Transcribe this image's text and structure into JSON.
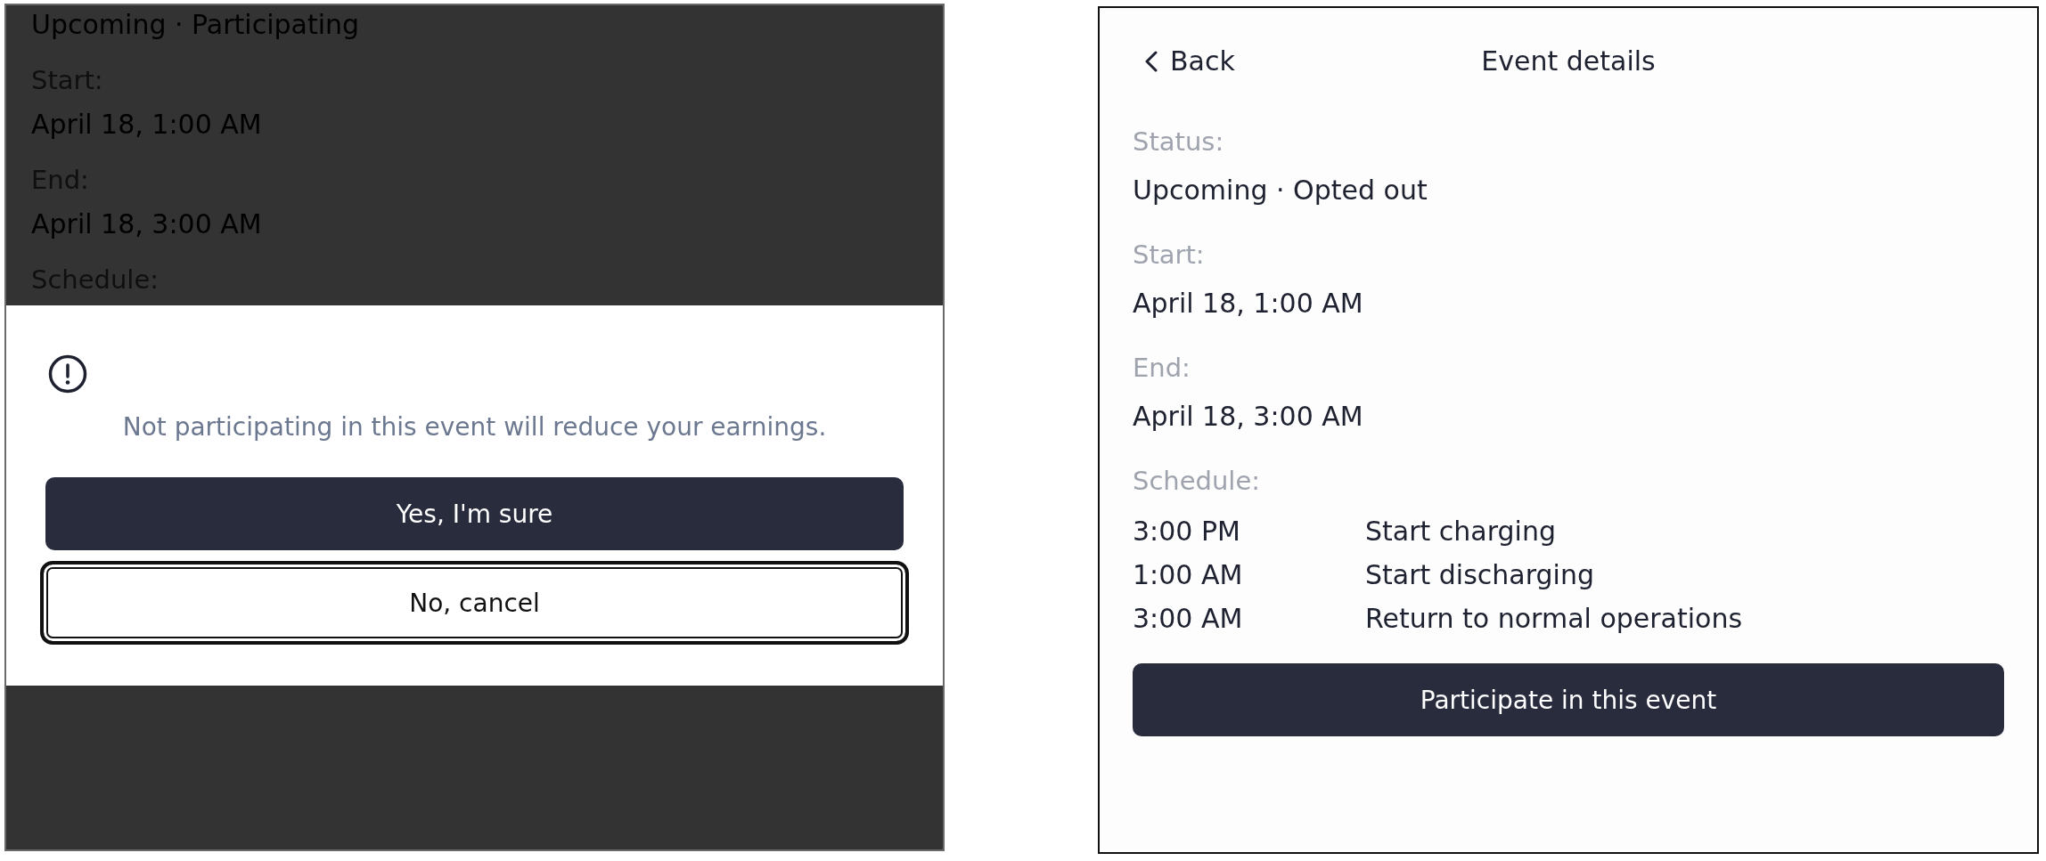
{
  "dimmed_screen": {
    "status_value": "Upcoming · Participating",
    "fields": [
      {
        "label": "Start:",
        "value": "April 18, 1:00 AM"
      },
      {
        "label": "End:",
        "value": "April 18, 3:00 AM"
      }
    ],
    "schedule_label": "Schedule:"
  },
  "confirm_dialog": {
    "message": "Not participating in this event will reduce your earnings.",
    "buttons": [
      {
        "label": "Yes, I'm sure",
        "kind": "confirm",
        "focused": false
      },
      {
        "label": "No, cancel",
        "kind": "cancel",
        "focused": true
      }
    ]
  },
  "event_details": {
    "back": "Back",
    "title": "Event details",
    "fields": [
      {
        "label": "Status:",
        "value": "Upcoming · Opted out"
      },
      {
        "label": "Start:",
        "value": "April 18, 1:00 AM"
      },
      {
        "label": "End:",
        "value": "April 18, 3:00 AM"
      }
    ],
    "schedule_label": "Schedule:",
    "schedule": [
      {
        "time": "3:00 PM",
        "action": "Start charging"
      },
      {
        "time": "1:00 AM",
        "action": "Start discharging"
      },
      {
        "time": "3:00 AM",
        "action": "Return to normal operations"
      }
    ],
    "action_button": "Participate in this event"
  }
}
